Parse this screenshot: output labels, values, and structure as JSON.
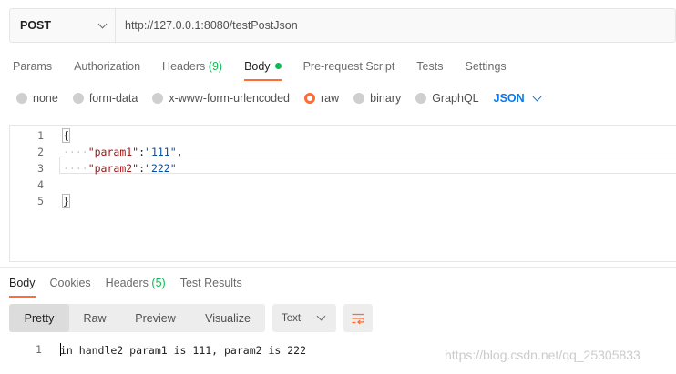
{
  "request": {
    "method": "POST",
    "url": "http://127.0.0.1:8080/testPostJson"
  },
  "request_tabs": [
    {
      "label": "Params"
    },
    {
      "label": "Authorization"
    },
    {
      "label": "Headers",
      "count": "(9)"
    },
    {
      "label": "Body",
      "active": true
    },
    {
      "label": "Pre-request Script"
    },
    {
      "label": "Tests"
    },
    {
      "label": "Settings"
    }
  ],
  "body_types": [
    {
      "label": "none",
      "selected": false
    },
    {
      "label": "form-data",
      "selected": false
    },
    {
      "label": "x-www-form-urlencoded",
      "selected": false
    },
    {
      "label": "raw",
      "selected": true
    },
    {
      "label": "binary",
      "selected": false
    },
    {
      "label": "GraphQL",
      "selected": false
    }
  ],
  "raw_format": "JSON",
  "editor": {
    "line_numbers": [
      "1",
      "2",
      "3",
      "4",
      "5"
    ],
    "lines": {
      "l1": "{",
      "l2_key": "\"param1\"",
      "l2_colon": ":",
      "l2_val": "\"111\"",
      "l2_comma": ",",
      "l3_key": "\"param2\"",
      "l3_colon": ":",
      "l3_val": "\"222\"",
      "l5": "}"
    },
    "indent_marker": "····"
  },
  "response_tabs": [
    {
      "label": "Body",
      "active": true
    },
    {
      "label": "Cookies"
    },
    {
      "label": "Headers",
      "count": "(5)"
    },
    {
      "label": "Test Results"
    }
  ],
  "view_modes": [
    {
      "label": "Pretty",
      "active": true
    },
    {
      "label": "Raw"
    },
    {
      "label": "Preview"
    },
    {
      "label": "Visualize"
    }
  ],
  "response_format": "Text",
  "response": {
    "line_number": "1",
    "text": "in handle2 param1 is 111, param2 is 222"
  },
  "watermark": "https://blog.csdn.net/qq_25305833",
  "colors": {
    "accent": "#ff6c37",
    "status_green": "#0cbb52",
    "link_blue": "#097bed"
  },
  "icons": [
    "chevron-down-icon",
    "wrap-lines-icon",
    "radio-icon",
    "status-dot-icon"
  ]
}
